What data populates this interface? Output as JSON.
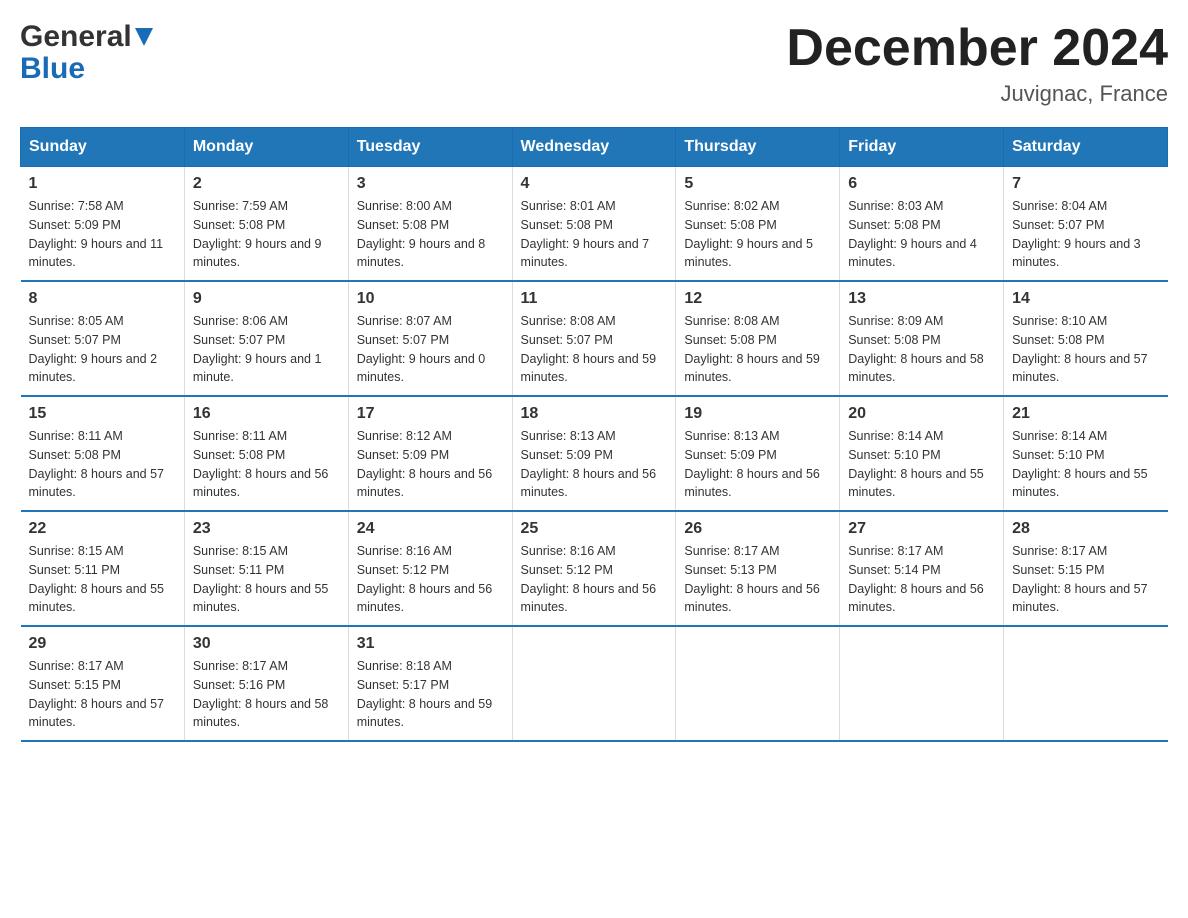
{
  "header": {
    "logo_general": "General",
    "logo_blue": "Blue",
    "month_title": "December 2024",
    "location": "Juvignac, France"
  },
  "days_of_week": [
    "Sunday",
    "Monday",
    "Tuesday",
    "Wednesday",
    "Thursday",
    "Friday",
    "Saturday"
  ],
  "weeks": [
    [
      {
        "day": "1",
        "sunrise": "Sunrise: 7:58 AM",
        "sunset": "Sunset: 5:09 PM",
        "daylight": "Daylight: 9 hours and 11 minutes."
      },
      {
        "day": "2",
        "sunrise": "Sunrise: 7:59 AM",
        "sunset": "Sunset: 5:08 PM",
        "daylight": "Daylight: 9 hours and 9 minutes."
      },
      {
        "day": "3",
        "sunrise": "Sunrise: 8:00 AM",
        "sunset": "Sunset: 5:08 PM",
        "daylight": "Daylight: 9 hours and 8 minutes."
      },
      {
        "day": "4",
        "sunrise": "Sunrise: 8:01 AM",
        "sunset": "Sunset: 5:08 PM",
        "daylight": "Daylight: 9 hours and 7 minutes."
      },
      {
        "day": "5",
        "sunrise": "Sunrise: 8:02 AM",
        "sunset": "Sunset: 5:08 PM",
        "daylight": "Daylight: 9 hours and 5 minutes."
      },
      {
        "day": "6",
        "sunrise": "Sunrise: 8:03 AM",
        "sunset": "Sunset: 5:08 PM",
        "daylight": "Daylight: 9 hours and 4 minutes."
      },
      {
        "day": "7",
        "sunrise": "Sunrise: 8:04 AM",
        "sunset": "Sunset: 5:07 PM",
        "daylight": "Daylight: 9 hours and 3 minutes."
      }
    ],
    [
      {
        "day": "8",
        "sunrise": "Sunrise: 8:05 AM",
        "sunset": "Sunset: 5:07 PM",
        "daylight": "Daylight: 9 hours and 2 minutes."
      },
      {
        "day": "9",
        "sunrise": "Sunrise: 8:06 AM",
        "sunset": "Sunset: 5:07 PM",
        "daylight": "Daylight: 9 hours and 1 minute."
      },
      {
        "day": "10",
        "sunrise": "Sunrise: 8:07 AM",
        "sunset": "Sunset: 5:07 PM",
        "daylight": "Daylight: 9 hours and 0 minutes."
      },
      {
        "day": "11",
        "sunrise": "Sunrise: 8:08 AM",
        "sunset": "Sunset: 5:07 PM",
        "daylight": "Daylight: 8 hours and 59 minutes."
      },
      {
        "day": "12",
        "sunrise": "Sunrise: 8:08 AM",
        "sunset": "Sunset: 5:08 PM",
        "daylight": "Daylight: 8 hours and 59 minutes."
      },
      {
        "day": "13",
        "sunrise": "Sunrise: 8:09 AM",
        "sunset": "Sunset: 5:08 PM",
        "daylight": "Daylight: 8 hours and 58 minutes."
      },
      {
        "day": "14",
        "sunrise": "Sunrise: 8:10 AM",
        "sunset": "Sunset: 5:08 PM",
        "daylight": "Daylight: 8 hours and 57 minutes."
      }
    ],
    [
      {
        "day": "15",
        "sunrise": "Sunrise: 8:11 AM",
        "sunset": "Sunset: 5:08 PM",
        "daylight": "Daylight: 8 hours and 57 minutes."
      },
      {
        "day": "16",
        "sunrise": "Sunrise: 8:11 AM",
        "sunset": "Sunset: 5:08 PM",
        "daylight": "Daylight: 8 hours and 56 minutes."
      },
      {
        "day": "17",
        "sunrise": "Sunrise: 8:12 AM",
        "sunset": "Sunset: 5:09 PM",
        "daylight": "Daylight: 8 hours and 56 minutes."
      },
      {
        "day": "18",
        "sunrise": "Sunrise: 8:13 AM",
        "sunset": "Sunset: 5:09 PM",
        "daylight": "Daylight: 8 hours and 56 minutes."
      },
      {
        "day": "19",
        "sunrise": "Sunrise: 8:13 AM",
        "sunset": "Sunset: 5:09 PM",
        "daylight": "Daylight: 8 hours and 56 minutes."
      },
      {
        "day": "20",
        "sunrise": "Sunrise: 8:14 AM",
        "sunset": "Sunset: 5:10 PM",
        "daylight": "Daylight: 8 hours and 55 minutes."
      },
      {
        "day": "21",
        "sunrise": "Sunrise: 8:14 AM",
        "sunset": "Sunset: 5:10 PM",
        "daylight": "Daylight: 8 hours and 55 minutes."
      }
    ],
    [
      {
        "day": "22",
        "sunrise": "Sunrise: 8:15 AM",
        "sunset": "Sunset: 5:11 PM",
        "daylight": "Daylight: 8 hours and 55 minutes."
      },
      {
        "day": "23",
        "sunrise": "Sunrise: 8:15 AM",
        "sunset": "Sunset: 5:11 PM",
        "daylight": "Daylight: 8 hours and 55 minutes."
      },
      {
        "day": "24",
        "sunrise": "Sunrise: 8:16 AM",
        "sunset": "Sunset: 5:12 PM",
        "daylight": "Daylight: 8 hours and 56 minutes."
      },
      {
        "day": "25",
        "sunrise": "Sunrise: 8:16 AM",
        "sunset": "Sunset: 5:12 PM",
        "daylight": "Daylight: 8 hours and 56 minutes."
      },
      {
        "day": "26",
        "sunrise": "Sunrise: 8:17 AM",
        "sunset": "Sunset: 5:13 PM",
        "daylight": "Daylight: 8 hours and 56 minutes."
      },
      {
        "day": "27",
        "sunrise": "Sunrise: 8:17 AM",
        "sunset": "Sunset: 5:14 PM",
        "daylight": "Daylight: 8 hours and 56 minutes."
      },
      {
        "day": "28",
        "sunrise": "Sunrise: 8:17 AM",
        "sunset": "Sunset: 5:15 PM",
        "daylight": "Daylight: 8 hours and 57 minutes."
      }
    ],
    [
      {
        "day": "29",
        "sunrise": "Sunrise: 8:17 AM",
        "sunset": "Sunset: 5:15 PM",
        "daylight": "Daylight: 8 hours and 57 minutes."
      },
      {
        "day": "30",
        "sunrise": "Sunrise: 8:17 AM",
        "sunset": "Sunset: 5:16 PM",
        "daylight": "Daylight: 8 hours and 58 minutes."
      },
      {
        "day": "31",
        "sunrise": "Sunrise: 8:18 AM",
        "sunset": "Sunset: 5:17 PM",
        "daylight": "Daylight: 8 hours and 59 minutes."
      },
      null,
      null,
      null,
      null
    ]
  ]
}
